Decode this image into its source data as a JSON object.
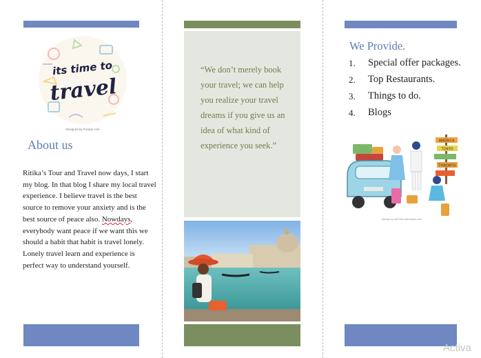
{
  "left_panel": {
    "logo_line1": "its time to",
    "logo_line2": "travel",
    "logo_credit": "designed by freepik.com",
    "about_title": "About us",
    "about_body_1": "Ritika’s Tour and  Travel now days, I start my blog. In that blog I share my local travel experience.  I believe travel is the best source to remove your anxiety and is the best source of peace also. ",
    "about_body_misspelled": "Nowdays",
    "about_body_2": ", everybody want peace if we want this we  should a habit that habit is travel lonely. Lonely travel learn and experience is perfect way to understand yourself."
  },
  "middle_panel": {
    "quote": "“We don’t merely book your travel; we can help you realize your travel dreams if you give us an idea of what kind of experience you seek.”"
  },
  "right_panel": {
    "title": "We Provide.",
    "items": [
      {
        "num": "1.",
        "label": "Special offer packages."
      },
      {
        "num": "2.",
        "label": "Top Restaurants."
      },
      {
        "num": "3.",
        "label": "Things to do."
      },
      {
        "num": "4.",
        "label": "Blogs"
      }
    ],
    "signpost": [
      "AMERICA",
      "TOKYO",
      "TORONTO"
    ],
    "illustration_credit": "Design by Alf free download.com"
  },
  "watermark": "Activa",
  "colors": {
    "accent_blue": "#6f88c1",
    "accent_green": "#7a8e60",
    "quote_bg": "#e4e7df",
    "heading_blue": "#5b7cb6"
  }
}
